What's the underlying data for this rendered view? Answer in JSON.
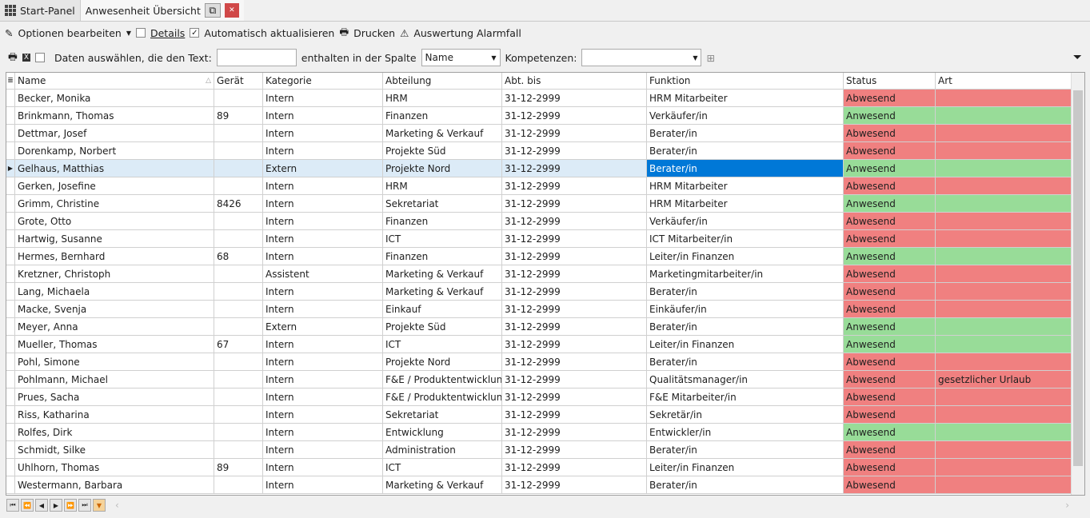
{
  "tabs": {
    "start": "Start-Panel",
    "active": "Anwesenheit Übersicht"
  },
  "toolbar": {
    "options": "Optionen bearbeiten",
    "details": "Details",
    "details_checked": false,
    "auto": "Automatisch aktualisieren",
    "auto_checked": true,
    "print": "Drucken",
    "alarm": "Auswertung Alarmfall"
  },
  "filter": {
    "label1": "Daten auswählen, die den Text:",
    "text_value": "",
    "label2": "enthalten in der Spalte",
    "column": "Name",
    "label3": "Kompetenzen:",
    "competence": ""
  },
  "columns": [
    "Name",
    "Gerät",
    "Kategorie",
    "Abteilung",
    "Abt. bis",
    "Funktion",
    "Status",
    "Art"
  ],
  "colors": {
    "absent": "#f08080",
    "present": "#98dc98",
    "selection": "#0078d7"
  },
  "rows": [
    [
      "Becker, Monika",
      "",
      "Intern",
      "HRM",
      "31-12-2999",
      "HRM Mitarbeiter",
      "Abwesend",
      ""
    ],
    [
      "Brinkmann, Thomas",
      "89",
      "Intern",
      "Finanzen",
      "31-12-2999",
      "Verkäufer/in",
      "Anwesend",
      ""
    ],
    [
      "Dettmar, Josef",
      "",
      "Intern",
      "Marketing & Verkauf",
      "31-12-2999",
      "Berater/in",
      "Abwesend",
      ""
    ],
    [
      "Dorenkamp, Norbert",
      "",
      "Intern",
      "Projekte Süd",
      "31-12-2999",
      "Berater/in",
      "Abwesend",
      ""
    ],
    [
      "Gelhaus, Matthias",
      "",
      "Extern",
      "Projekte Nord",
      "31-12-2999",
      "Berater/in",
      "Anwesend",
      ""
    ],
    [
      "Gerken, Josefine",
      "",
      "Intern",
      "HRM",
      "31-12-2999",
      "HRM Mitarbeiter",
      "Abwesend",
      ""
    ],
    [
      "Grimm, Christine",
      "8426",
      "Intern",
      "Sekretariat",
      "31-12-2999",
      "HRM Mitarbeiter",
      "Anwesend",
      ""
    ],
    [
      "Grote, Otto",
      "",
      "Intern",
      "Finanzen",
      "31-12-2999",
      "Verkäufer/in",
      "Abwesend",
      ""
    ],
    [
      "Hartwig, Susanne",
      "",
      "Intern",
      "ICT",
      "31-12-2999",
      "ICT Mitarbeiter/in",
      "Abwesend",
      ""
    ],
    [
      "Hermes, Bernhard",
      "68",
      "Intern",
      "Finanzen",
      "31-12-2999",
      "Leiter/in Finanzen",
      "Anwesend",
      ""
    ],
    [
      "Kretzner, Christoph",
      "",
      "Assistent",
      "Marketing & Verkauf",
      "31-12-2999",
      "Marketingmitarbeiter/in",
      "Abwesend",
      ""
    ],
    [
      "Lang, Michaela",
      "",
      "Intern",
      "Marketing & Verkauf",
      "31-12-2999",
      "Berater/in",
      "Abwesend",
      ""
    ],
    [
      "Macke, Svenja",
      "",
      "Intern",
      "Einkauf",
      "31-12-2999",
      "Einkäufer/in",
      "Abwesend",
      ""
    ],
    [
      "Meyer, Anna",
      "",
      "Extern",
      "Projekte Süd",
      "31-12-2999",
      "Berater/in",
      "Anwesend",
      ""
    ],
    [
      "Mueller, Thomas",
      "67",
      "Intern",
      "ICT",
      "31-12-2999",
      "Leiter/in Finanzen",
      "Anwesend",
      ""
    ],
    [
      "Pohl, Simone",
      "",
      "Intern",
      "Projekte Nord",
      "31-12-2999",
      "Berater/in",
      "Abwesend",
      ""
    ],
    [
      "Pohlmann, Michael",
      "",
      "Intern",
      "F&E / Produktentwicklung",
      "31-12-2999",
      "Qualitätsmanager/in",
      "Abwesend",
      "gesetzlicher Urlaub"
    ],
    [
      "Prues, Sacha",
      "",
      "Intern",
      "F&E / Produktentwicklung",
      "31-12-2999",
      "F&E Mitarbeiter/in",
      "Abwesend",
      ""
    ],
    [
      "Riss, Katharina",
      "",
      "Intern",
      "Sekretariat",
      "31-12-2999",
      "Sekretär/in",
      "Abwesend",
      ""
    ],
    [
      "Rolfes, Dirk",
      "",
      "Intern",
      "Entwicklung",
      "31-12-2999",
      "Entwickler/in",
      "Anwesend",
      ""
    ],
    [
      "Schmidt, Silke",
      "",
      "Intern",
      "Administration",
      "31-12-2999",
      "Berater/in",
      "Abwesend",
      ""
    ],
    [
      "Uhlhorn, Thomas",
      "89",
      "Intern",
      "ICT",
      "31-12-2999",
      "Leiter/in Finanzen",
      "Abwesend",
      ""
    ],
    [
      "Westermann, Barbara",
      "",
      "Intern",
      "Marketing & Verkauf",
      "31-12-2999",
      "Berater/in",
      "Abwesend",
      ""
    ]
  ],
  "selected_row": 4
}
